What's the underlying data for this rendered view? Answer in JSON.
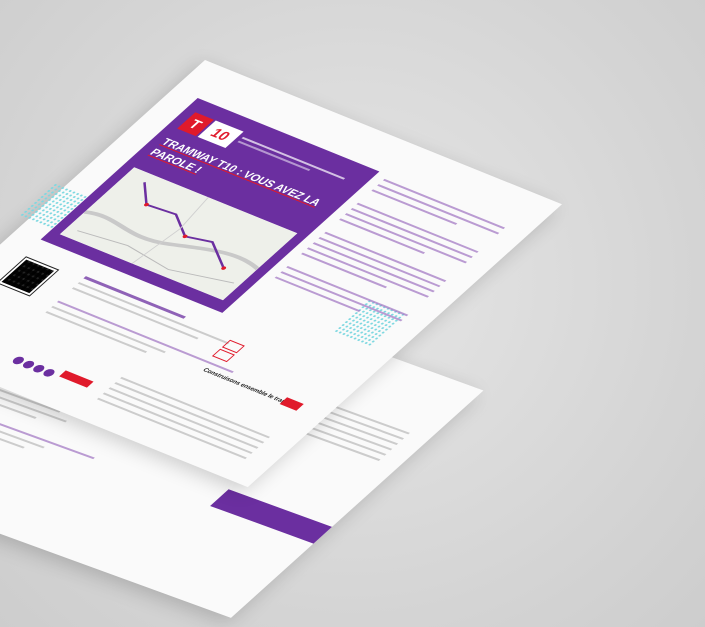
{
  "flyer": {
    "logo_letter": "T",
    "logo_number": "10",
    "title": "TRAMWAY T10 : VOUS AVEZ LA PAROLE !",
    "tagline": "Construisons ensemble le tramway"
  },
  "colors": {
    "purple": "#6b2fa0",
    "red": "#e01a2b",
    "turquoise": "#7dd8e0",
    "paper": "#fafafa"
  },
  "icons": [
    "qr-code-icon",
    "map-icon",
    "social-icons"
  ]
}
